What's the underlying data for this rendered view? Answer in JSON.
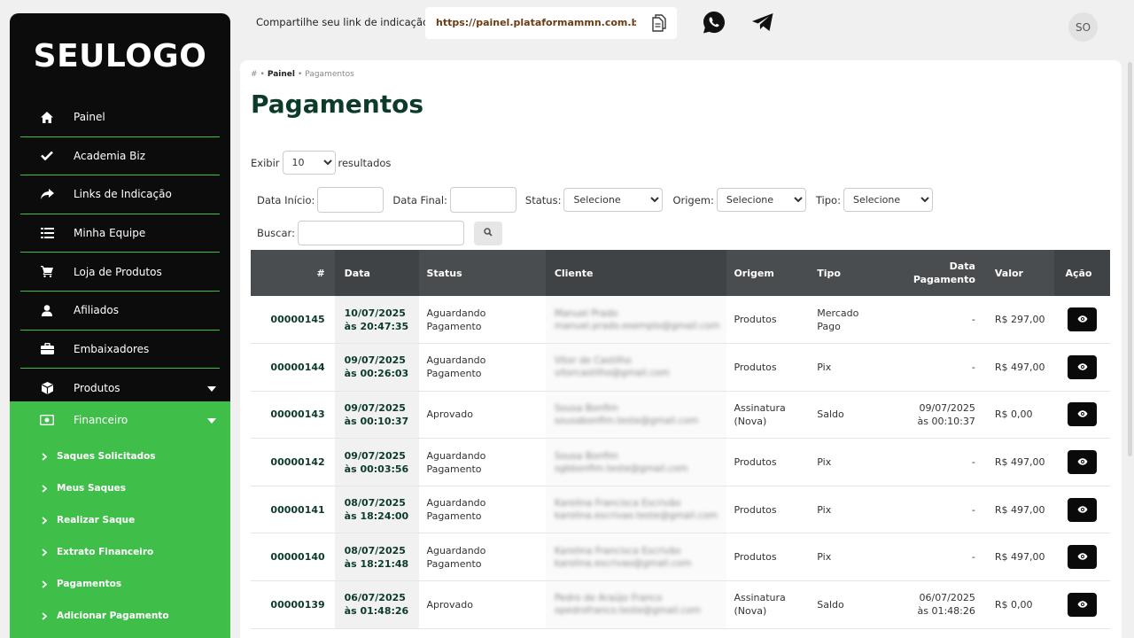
{
  "sidebar": {
    "logo": "SEULOGO",
    "items": [
      {
        "label": "Painel",
        "icon": "home-icon"
      },
      {
        "label": "Academia Biz",
        "icon": "check-icon"
      },
      {
        "label": "Links de Indicação",
        "icon": "share-icon"
      },
      {
        "label": "Minha Equipe",
        "icon": "list-icon"
      },
      {
        "label": "Loja de Produtos",
        "icon": "cart-icon"
      },
      {
        "label": "Afiliados",
        "icon": "user-icon"
      },
      {
        "label": "Embaixadores",
        "icon": "briefcase-icon"
      },
      {
        "label": "Produtos",
        "icon": "cube-icon"
      },
      {
        "label": "Financeiro",
        "icon": "money-icon"
      }
    ],
    "sub_items": [
      {
        "label": "Saques Solicitados"
      },
      {
        "label": "Meus Saques"
      },
      {
        "label": "Realizar Saque"
      },
      {
        "label": "Extrato Financeiro"
      },
      {
        "label": "Pagamentos"
      },
      {
        "label": "Adicionar Pagamento"
      }
    ],
    "accent": "#3fbf4a",
    "background": "#0c0c0c"
  },
  "topbar": {
    "share_label": "Compartilhe seu link de indicação:",
    "share_url": "https://painel.plataformammn.com.br/c...",
    "avatar_initials": "SO"
  },
  "breadcrumb": {
    "home": "#",
    "sep1": "•",
    "painel": "Painel",
    "sep2": "•",
    "current": "Pagamentos"
  },
  "page": {
    "title": "Pagamentos"
  },
  "filters": {
    "show_label": "Exibir",
    "show_value": "10",
    "results_label": "resultados",
    "date_start_label": "Data Início:",
    "date_end_label": "Data Final:",
    "status_label": "Status:",
    "status_value": "Selecione",
    "origin_label": "Origem:",
    "origin_value": "Selecione",
    "type_label": "Tipo:",
    "type_value": "Selecione",
    "search_label": "Buscar:"
  },
  "table": {
    "headers": {
      "id": "#",
      "date": "Data",
      "status": "Status",
      "client": "Cliente",
      "origin": "Origem",
      "type": "Tipo",
      "paid_date_1": "Data",
      "paid_date_2": "Pagamento",
      "value": "Valor",
      "action": "Ação"
    },
    "rows": [
      {
        "id": "00000145",
        "date": "10/07/2025",
        "time": "às 20:47:35",
        "status": "Aguardando Pagamento",
        "client_name": "Manuel Prado",
        "client_email": "manuel.prado.exemplo@gmail.com",
        "origin_1": "Produtos",
        "origin_2": "",
        "type_1": "Mercado",
        "type_2": "Pago",
        "paid_date": "-",
        "paid_time": "",
        "value": "R$ 297,00"
      },
      {
        "id": "00000144",
        "date": "09/07/2025",
        "time": "às 00:26:03",
        "status": "Aguardando Pagamento",
        "client_name": "Vitor de Castilho",
        "client_email": "vitorcastilho@gmail.com",
        "origin_1": "Produtos",
        "origin_2": "",
        "type_1": "Pix",
        "type_2": "",
        "paid_date": "-",
        "paid_time": "",
        "value": "R$ 497,00"
      },
      {
        "id": "00000143",
        "date": "09/07/2025",
        "time": "às 00:10:37",
        "status": "Aprovado",
        "client_name": "Sousa Bonfim",
        "client_email": "sousabonfim.teste@gmail.com",
        "origin_1": "Assinatura",
        "origin_2": "(Nova)",
        "type_1": "Saldo",
        "type_2": "",
        "paid_date": "09/07/2025",
        "paid_time": "às 00:10:37",
        "value": "R$ 0,00"
      },
      {
        "id": "00000142",
        "date": "09/07/2025",
        "time": "às 00:03:56",
        "status": "Aguardando Pagamento",
        "client_name": "Sousa Bonfim",
        "client_email": "sgbbonfim.teste@gmail.com",
        "origin_1": "Produtos",
        "origin_2": "",
        "type_1": "Pix",
        "type_2": "",
        "paid_date": "-",
        "paid_time": "",
        "value": "R$ 497,00"
      },
      {
        "id": "00000141",
        "date": "08/07/2025",
        "time": "às 18:24:00",
        "status": "Aguardando Pagamento",
        "client_name": "Karolina Francisca Escrivão",
        "client_email": "karolina.escrivao.teste@gmail.com",
        "origin_1": "Produtos",
        "origin_2": "",
        "type_1": "Pix",
        "type_2": "",
        "paid_date": "-",
        "paid_time": "",
        "value": "R$ 497,00"
      },
      {
        "id": "00000140",
        "date": "08/07/2025",
        "time": "às 18:21:48",
        "status": "Aguardando Pagamento",
        "client_name": "Karolina Francisca Escrivão",
        "client_email": "karolina.escrivao@gmail.com",
        "origin_1": "Produtos",
        "origin_2": "",
        "type_1": "Pix",
        "type_2": "",
        "paid_date": "-",
        "paid_time": "",
        "value": "R$ 497,00"
      },
      {
        "id": "00000139",
        "date": "06/07/2025",
        "time": "às 01:48:26",
        "status": "Aprovado",
        "client_name": "Pedro de Araújo Franco",
        "client_email": "opedrofranco.teste@gmail.com",
        "origin_1": "Assinatura",
        "origin_2": "(Nova)",
        "type_1": "Saldo",
        "type_2": "",
        "paid_date": "06/07/2025",
        "paid_time": "às 01:48:26",
        "value": "R$ 0,00"
      }
    ]
  }
}
